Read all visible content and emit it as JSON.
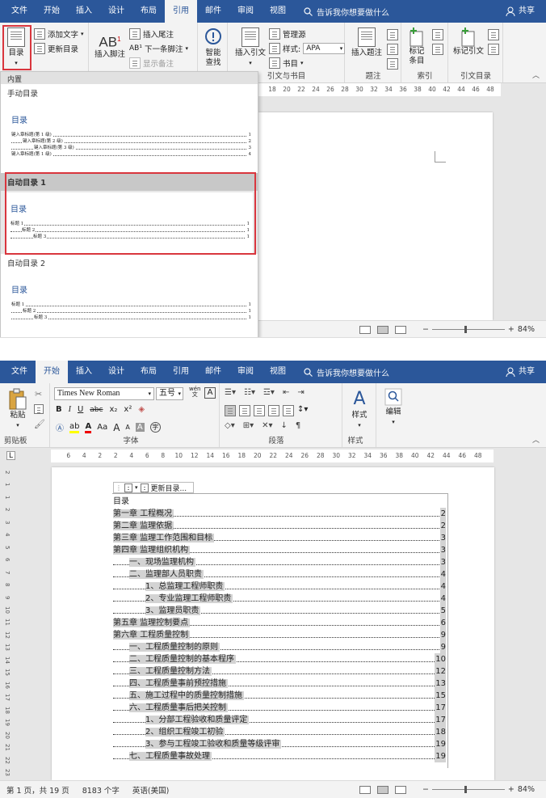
{
  "top": {
    "tabs": [
      "文件",
      "开始",
      "插入",
      "设计",
      "布局",
      "引用",
      "邮件",
      "审阅",
      "视图"
    ],
    "active_tab": "引用",
    "tell_me": "告诉我你想要做什么",
    "share": "共享",
    "ribbon": {
      "toc_button": "目录",
      "add_text": "添加文字",
      "update_toc": "更新目录",
      "insert_footnote": "插入脚注",
      "insert_endnote": "插入尾注",
      "next_footnote": "下一条脚注",
      "show_notes": "显示备注",
      "smart_lookup_1": "智能",
      "smart_lookup_2": "查找",
      "insert_citation": "插入引文",
      "manage_sources": "管理源",
      "style_label": "样式:",
      "style_value": "APA",
      "bibliography": "书目",
      "insert_caption": "插入题注",
      "mark_entry_1": "标记",
      "mark_entry_2": "条目",
      "mark_citation": "标记引文",
      "group_citations": "引文与书目",
      "group_captions": "题注",
      "group_index": "索引",
      "group_authorities": "引文目录"
    },
    "ruler_ticks": [
      "18",
      "20",
      "22",
      "24",
      "26",
      "28",
      "30",
      "32",
      "34",
      "36",
      "38",
      "40",
      "42",
      "44",
      "46",
      "48"
    ],
    "dropdown": {
      "builtin": "内置",
      "manual_title": "手动目录",
      "manual_toc_heading": "目录",
      "manual_lines": [
        {
          "text": "键入章标题(第 1 级)",
          "page": "1",
          "indent": 0
        },
        {
          "text": "键入章标题(第 2 级)",
          "page": "2",
          "indent": 1
        },
        {
          "text": "键入章标题(第 3 级)",
          "page": "3",
          "indent": 2
        },
        {
          "text": "键入章标题(第 1 级)",
          "page": "4",
          "indent": 0
        }
      ],
      "auto1_title": "自动目录 1",
      "auto1_toc_heading": "目录",
      "auto1_lines": [
        {
          "text": "标题 1",
          "page": "1",
          "indent": 0
        },
        {
          "text": "标题 2",
          "page": "1",
          "indent": 1
        },
        {
          "text": "标题 3",
          "page": "1",
          "indent": 2
        }
      ],
      "auto2_title": "自动目录 2",
      "auto2_toc_heading": "目录",
      "auto2_lines": [
        {
          "text": "标题 1",
          "page": "1",
          "indent": 0
        },
        {
          "text": "标题 2",
          "page": "1",
          "indent": 1
        },
        {
          "text": "标题 3",
          "page": "1",
          "indent": 2
        }
      ]
    },
    "zoom": "84%"
  },
  "bottom": {
    "tabs": [
      "文件",
      "开始",
      "插入",
      "设计",
      "布局",
      "引用",
      "邮件",
      "审阅",
      "视图"
    ],
    "active_tab": "开始",
    "tell_me": "告诉我你想要做什么",
    "share": "共享",
    "ribbon": {
      "paste": "粘贴",
      "font_name": "Times New Roman",
      "font_size": "五号",
      "wen": "wén",
      "group_clipboard": "剪贴板",
      "group_font": "字体",
      "group_paragraph": "段落",
      "group_styles": "样式",
      "styles_btn": "样式",
      "editing_btn": "编辑",
      "bold": "B",
      "italic": "I",
      "underline": "U",
      "strike": "abc",
      "sub": "x₂",
      "sup": "x²",
      "grow": "A",
      "shrink": "A",
      "case": "Aa"
    },
    "ruler_ticks": [
      "6",
      "4",
      "2",
      "2",
      "4",
      "6",
      "8",
      "10",
      "12",
      "14",
      "16",
      "18",
      "20",
      "22",
      "24",
      "26",
      "28",
      "30",
      "32",
      "34",
      "36",
      "38",
      "40",
      "42",
      "44",
      "46",
      "48"
    ],
    "vruler_ticks": [
      "2",
      "1",
      "1",
      "2",
      "3",
      "4",
      "5",
      "6",
      "7",
      "8",
      "9",
      "10",
      "11",
      "12",
      "13",
      "14",
      "15",
      "16",
      "17",
      "18",
      "19",
      "20",
      "21",
      "22",
      "23"
    ],
    "update_toc_btn": "更新目录...",
    "toc_heading": "目录",
    "toc": [
      {
        "text": "第一章   工程概况",
        "page": "2",
        "indent": 0
      },
      {
        "text": "第二章   监理依据",
        "page": "2",
        "indent": 0
      },
      {
        "text": "第三章   监理工作范围和目标",
        "page": "3",
        "indent": 0
      },
      {
        "text": "第四章   监理组织机构",
        "page": "3",
        "indent": 0
      },
      {
        "text": "一、现场监理机构",
        "page": "3",
        "indent": 1
      },
      {
        "text": "二、监理部人员职责",
        "page": "4",
        "indent": 1
      },
      {
        "text": "1、总监理工程师职责",
        "page": "4",
        "indent": 2
      },
      {
        "text": "2、专业监理工程师职责",
        "page": "4",
        "indent": 2
      },
      {
        "text": "3、监理员职责",
        "page": "5",
        "indent": 2
      },
      {
        "text": "第五章   监理控制要点",
        "page": "6",
        "indent": 0
      },
      {
        "text": "第六章   工程质量控制",
        "page": "9",
        "indent": 0
      },
      {
        "text": "一、工程质量控制的原则",
        "page": "9",
        "indent": 1
      },
      {
        "text": "二、工程质量控制的基本程序",
        "page": "10",
        "indent": 1
      },
      {
        "text": "三、工程质量控制方法",
        "page": "12",
        "indent": 1
      },
      {
        "text": "四、工程质量事前预控措施",
        "page": "13",
        "indent": 1
      },
      {
        "text": "五、施工过程中的质量控制措施",
        "page": "15",
        "indent": 1
      },
      {
        "text": "六、工程质量事后把关控制",
        "page": "17",
        "indent": 1
      },
      {
        "text": "1、分部工程验收和质量评定",
        "page": "17",
        "indent": 2
      },
      {
        "text": "2、组织工程竣工初验",
        "page": "18",
        "indent": 2
      },
      {
        "text": "3、参与工程竣工验收和质量等级评审",
        "page": "19",
        "indent": 2
      },
      {
        "text": "七、工程质量事故处理",
        "page": "19",
        "indent": 1
      }
    ],
    "status": {
      "page": "第 1 页，共 19 页",
      "words": "8183 个字",
      "lang": "英语(美国)"
    },
    "zoom": "84%"
  },
  "colors": {
    "word_blue": "#2b579a",
    "highlight_red": "#d9363e",
    "field_gray": "#d3d3d3"
  }
}
